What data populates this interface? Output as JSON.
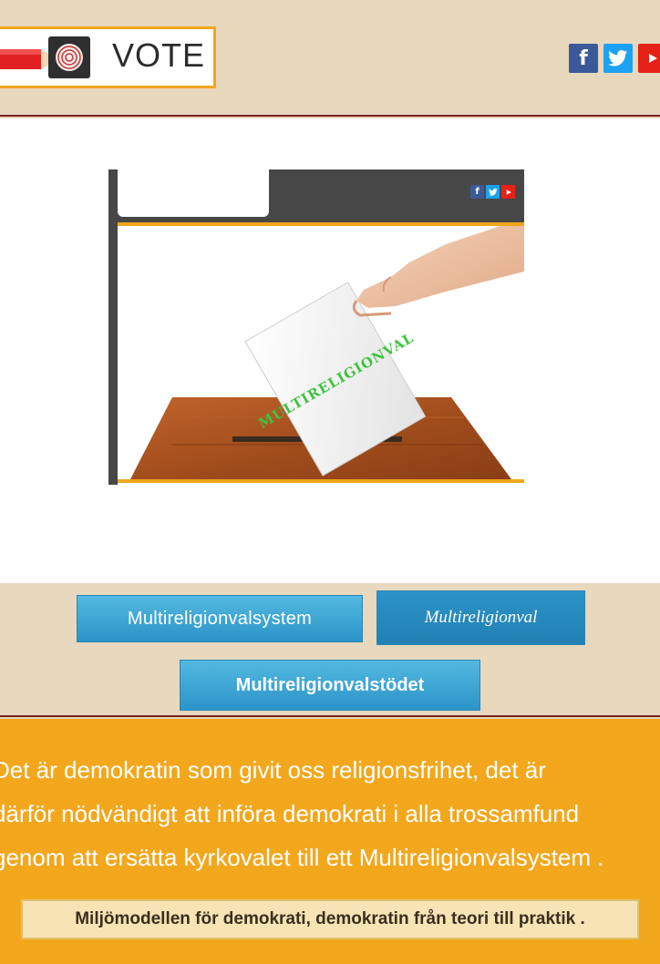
{
  "header": {
    "logo_text": "VOTE",
    "social": {
      "facebook": "f",
      "twitter": "t",
      "youtube": "y"
    }
  },
  "illustration": {
    "ballot_label": "MULTIRELIGIONVAL"
  },
  "buttons": {
    "system": "Multireligionvalsystem",
    "val": "Multireligionval",
    "stodet": "Multireligionvalstödet"
  },
  "intro": {
    "lines": [
      "Det är demokratin som givit oss religionsfrihet, det är",
      "därför nödvändigt att införa demokrati i alla trossamfund",
      "genom att ersätta kyrkovalet till ett Multireligionvalsystem ."
    ]
  },
  "footer_note": "Miljömodellen för demokrati, demokratin från teori till praktik .",
  "colors": {
    "accent_orange": "#f2a71d",
    "header_bg": "#e7d8be",
    "button_blue": "#2c94c7",
    "divider": "#7a1f1f"
  }
}
